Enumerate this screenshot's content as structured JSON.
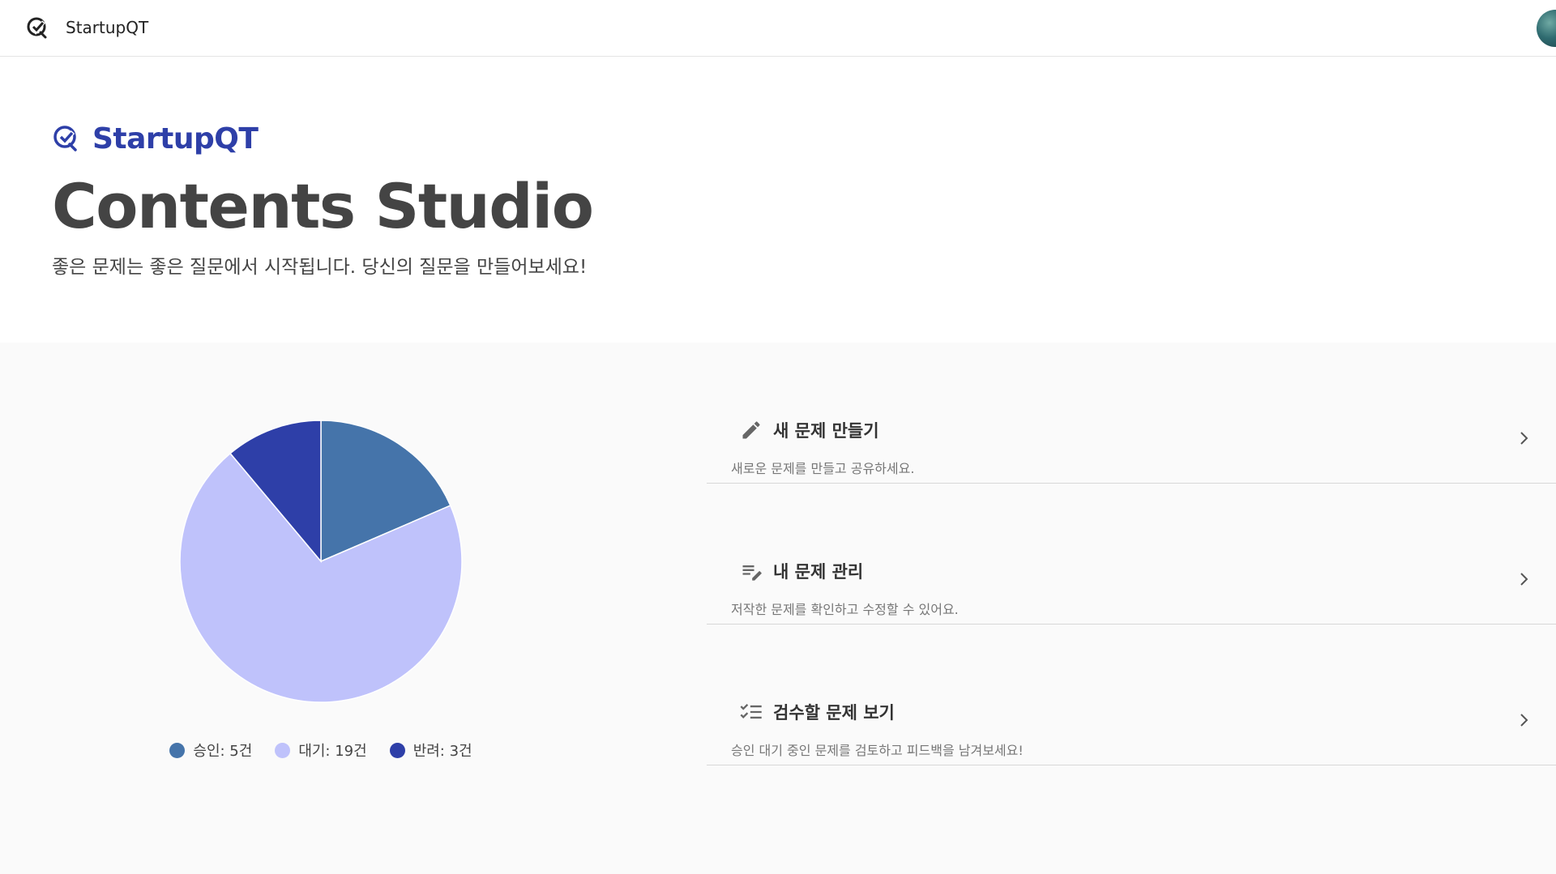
{
  "topbar": {
    "app_name": "StartupQT",
    "logo_icon": "startupqt-logo-icon",
    "avatar_icon": "user-avatar"
  },
  "hero": {
    "brand": "StartupQT",
    "title": "Contents Studio",
    "subtitle": "좋은 문제는 좋은 질문에서 시작됩니다. 당신의 질문을 만들어보세요!"
  },
  "chart_data": {
    "type": "pie",
    "categories": [
      "승인",
      "대기",
      "반려"
    ],
    "values": [
      5,
      19,
      3
    ],
    "colors": [
      "#4574aa",
      "#bfc2fb",
      "#2e3fa8"
    ],
    "legend": [
      "승인: 5건",
      "대기: 19건",
      "반려: 3건"
    ],
    "legend_placement": "bottom"
  },
  "actions": [
    {
      "title": "새 문제 만들기",
      "description": "새로운 문제를 만들고 공유하세요.",
      "icon": "pencil-icon"
    },
    {
      "title": "내 문제 관리",
      "description": "저작한 문제를 확인하고 수정할 수 있어요.",
      "icon": "edit-list-icon"
    },
    {
      "title": "검수할 문제 보기",
      "description": "승인 대기 중인 문제를 검토하고 피드백을 남겨보세요!",
      "icon": "checklist-icon"
    }
  ],
  "colors": {
    "brand": "#2e3fa8",
    "background": "#fafafa"
  }
}
